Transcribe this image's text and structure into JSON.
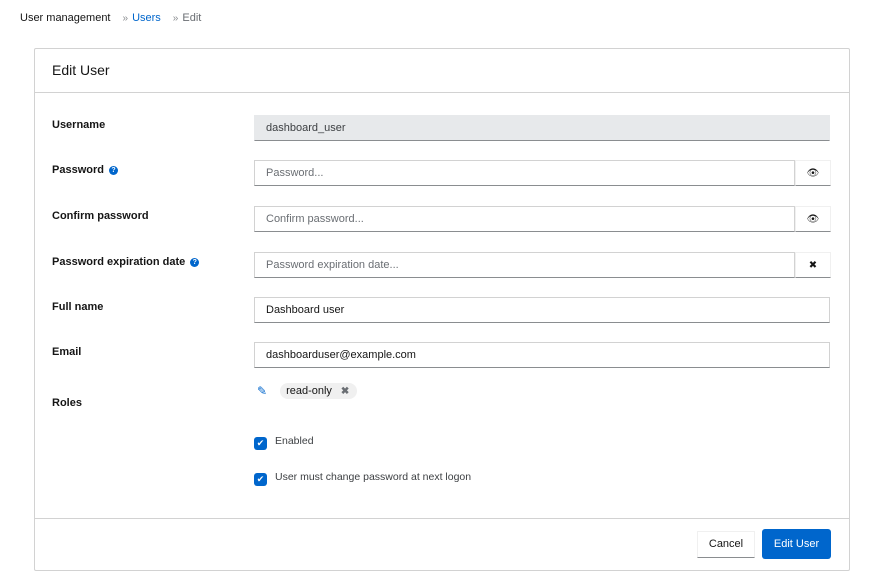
{
  "breadcrumb": {
    "items": [
      {
        "label": "User management"
      },
      {
        "label": "Users"
      },
      {
        "label": "Edit"
      }
    ],
    "separator": "»"
  },
  "card": {
    "title": "Edit User"
  },
  "form": {
    "username": {
      "label": "Username",
      "value": "dashboard_user"
    },
    "password": {
      "label": "Password",
      "placeholder": "Password...",
      "help_icon": "?",
      "toggle_icon": "eye-icon"
    },
    "confirm_password": {
      "label": "Confirm password",
      "placeholder": "Confirm password...",
      "toggle_icon": "eye-icon"
    },
    "password_expiration": {
      "label": "Password expiration date",
      "placeholder": "Password expiration date...",
      "help_icon": "?",
      "clear_icon": "close-icon"
    },
    "full_name": {
      "label": "Full name",
      "value": "Dashboard user"
    },
    "email": {
      "label": "Email",
      "value": "dashboarduser@example.com"
    },
    "roles": {
      "label": "Roles",
      "items": [
        {
          "label": "read-only"
        }
      ]
    },
    "enabled": {
      "label": "Enabled",
      "checked": true
    },
    "must_change_password": {
      "label": "User must change password at next logon",
      "checked": true
    }
  },
  "footer": {
    "cancel_label": "Cancel",
    "submit_label": "Edit User"
  },
  "icons": {
    "eye": "👁",
    "close": "✖",
    "pencil": "✎",
    "check": "✔"
  },
  "colors": {
    "primary": "#0066cc",
    "border": "#d2d2d2",
    "readonly_bg": "#e7e9eb"
  }
}
